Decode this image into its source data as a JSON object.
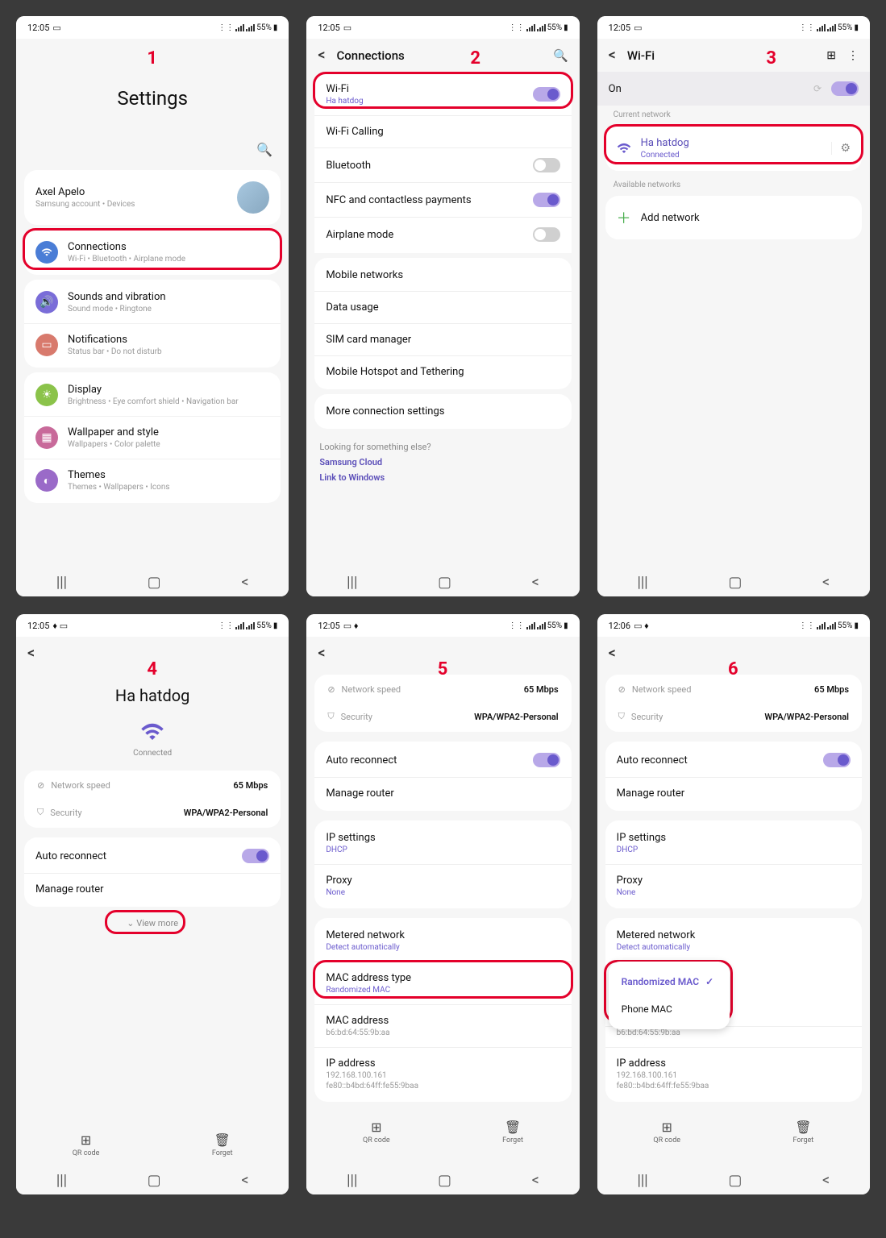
{
  "status": {
    "time": "12:05",
    "time6": "12:06",
    "battery": "55%"
  },
  "nav": {
    "recent": "|||",
    "home": "▢",
    "back": "<"
  },
  "s1": {
    "num": "1",
    "title": "Settings",
    "account": {
      "name": "Axel Apelo",
      "sub": "Samsung account  •  Devices"
    },
    "items": [
      {
        "icon": "📶",
        "color": "#4a7dd6",
        "title": "Connections",
        "sub": "Wi-Fi  •  Bluetooth  •  Airplane mode"
      },
      {
        "icon": "🔊",
        "color": "#7a6dd8",
        "title": "Sounds and vibration",
        "sub": "Sound mode  •  Ringtone"
      },
      {
        "icon": "🔔",
        "color": "#d87a6d",
        "title": "Notifications",
        "sub": "Status bar  •  Do not disturb"
      },
      {
        "icon": "☀",
        "color": "#8bc34a",
        "title": "Display",
        "sub": "Brightness  •  Eye comfort shield  •  Navigation bar"
      },
      {
        "icon": "🖼",
        "color": "#c86a9a",
        "title": "Wallpaper and style",
        "sub": "Wallpapers  •  Color palette"
      },
      {
        "icon": "🎨",
        "color": "#9a6ac8",
        "title": "Themes",
        "sub": "Themes  •  Wallpapers  •  Icons"
      }
    ]
  },
  "s2": {
    "num": "2",
    "title": "Connections",
    "items": [
      {
        "title": "Wi-Fi",
        "sub": "Ha hatdog",
        "subcolor": "purple",
        "toggle": true,
        "on": true
      },
      {
        "title": "Wi-Fi Calling"
      },
      {
        "title": "Bluetooth",
        "toggle": true,
        "on": false
      },
      {
        "title": "NFC and contactless payments",
        "toggle": true,
        "on": true
      },
      {
        "title": "Airplane mode",
        "toggle": true,
        "on": false
      },
      {
        "title": "Mobile networks"
      },
      {
        "title": "Data usage"
      },
      {
        "title": "SIM card manager"
      },
      {
        "title": "Mobile Hotspot and Tethering"
      },
      {
        "title": "More connection settings"
      }
    ],
    "looking": "Looking for something else?",
    "link1": "Samsung Cloud",
    "link2": "Link to Windows"
  },
  "s3": {
    "num": "3",
    "title": "Wi-Fi",
    "on": "On",
    "cur": "Current network",
    "net": {
      "name": "Ha hatdog",
      "status": "Connected"
    },
    "avail": "Available networks",
    "add": "Add network"
  },
  "s4": {
    "num": "4",
    "name": "Ha hatdog",
    "status": "Connected",
    "speed_l": "Network speed",
    "speed_v": "65 Mbps",
    "sec_l": "Security",
    "sec_v": "WPA/WPA2-Personal",
    "auto": "Auto reconnect",
    "manage": "Manage router",
    "viewmore": "View more",
    "qr": "QR code",
    "forget": "Forget"
  },
  "s5": {
    "num": "5",
    "speed_l": "Network speed",
    "speed_v": "65 Mbps",
    "sec_l": "Security",
    "sec_v": "WPA/WPA2-Personal",
    "auto": "Auto reconnect",
    "manage": "Manage router",
    "ip": "IP settings",
    "ip_v": "DHCP",
    "proxy": "Proxy",
    "proxy_v": "None",
    "metered": "Metered network",
    "metered_v": "Detect automatically",
    "mac_t": "MAC address type",
    "mac_t_v": "Randomized MAC",
    "mac": "MAC address",
    "mac_v": "b6:bd:64:55:9b:aa",
    "ipa": "IP address",
    "ipa_v1": "192.168.100.161",
    "ipa_v2": "fe80::b4bd:64ff:fe55:9baa",
    "qr": "QR code",
    "forget": "Forget"
  },
  "s6": {
    "num": "6",
    "speed_l": "Network speed",
    "speed_v": "65 Mbps",
    "sec_l": "Security",
    "sec_v": "WPA/WPA2-Personal",
    "auto": "Auto reconnect",
    "manage": "Manage router",
    "ip": "IP settings",
    "ip_v": "DHCP",
    "proxy": "Proxy",
    "proxy_v": "None",
    "metered": "Metered network",
    "metered_v": "Detect automatically",
    "opt1": "Randomized MAC",
    "opt2": "Phone MAC",
    "mac_v": "b6:bd:64:55:9b:aa",
    "ipa": "IP address",
    "ipa_v1": "192.168.100.161",
    "ipa_v2": "fe80::b4bd:64ff:fe55:9baa",
    "qr": "QR code",
    "forget": "Forget"
  }
}
